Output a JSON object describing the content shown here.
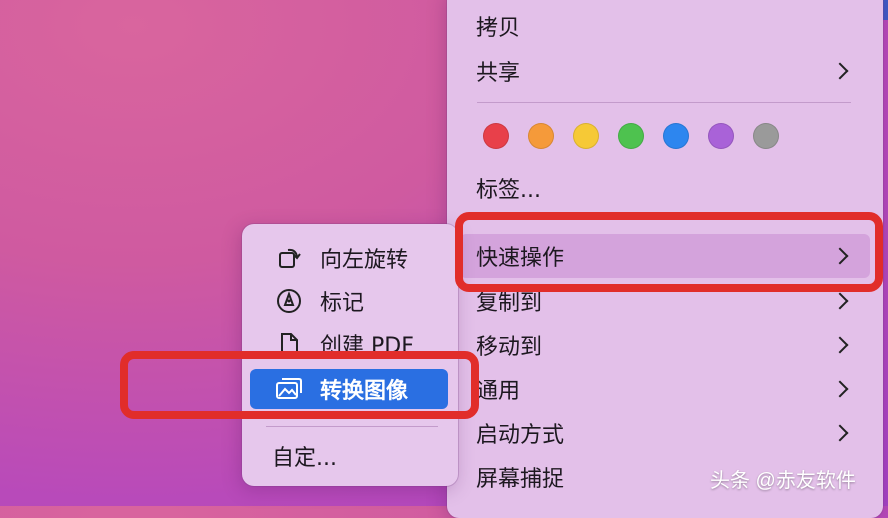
{
  "main_menu": {
    "copy": "拷贝",
    "share": "共享",
    "tag_colors": [
      "#e8404a",
      "#f59a3a",
      "#f6c936",
      "#4ec24f",
      "#2d86ef",
      "#a962d8",
      "#9a9a9a"
    ],
    "tags": "标签...",
    "quick_actions": "快速操作",
    "copy_to": "复制到",
    "move_to": "移动到",
    "general": "通用",
    "open_with": "启动方式",
    "screenshot": "屏幕捕捉"
  },
  "sub_menu": {
    "rotate_left": "向左旋转",
    "markup": "标记",
    "create_pdf": "创建 PDF",
    "convert_image": "转换图像",
    "customize": "自定..."
  },
  "watermark": "头条 @赤友软件",
  "annotation_color": "#e12d2a",
  "highlight_color": "#2a6fe2"
}
